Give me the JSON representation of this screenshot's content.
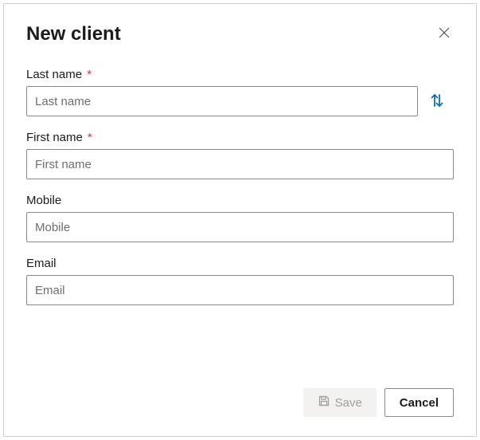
{
  "dialog": {
    "title": "New client"
  },
  "fields": {
    "last_name": {
      "label": "Last name",
      "placeholder": "Last name",
      "value": "",
      "required_mark": "*"
    },
    "first_name": {
      "label": "First name",
      "placeholder": "First name",
      "value": "",
      "required_mark": "*"
    },
    "mobile": {
      "label": "Mobile",
      "placeholder": "Mobile",
      "value": ""
    },
    "email": {
      "label": "Email",
      "placeholder": "Email",
      "value": ""
    }
  },
  "footer": {
    "save_label": "Save",
    "cancel_label": "Cancel"
  }
}
